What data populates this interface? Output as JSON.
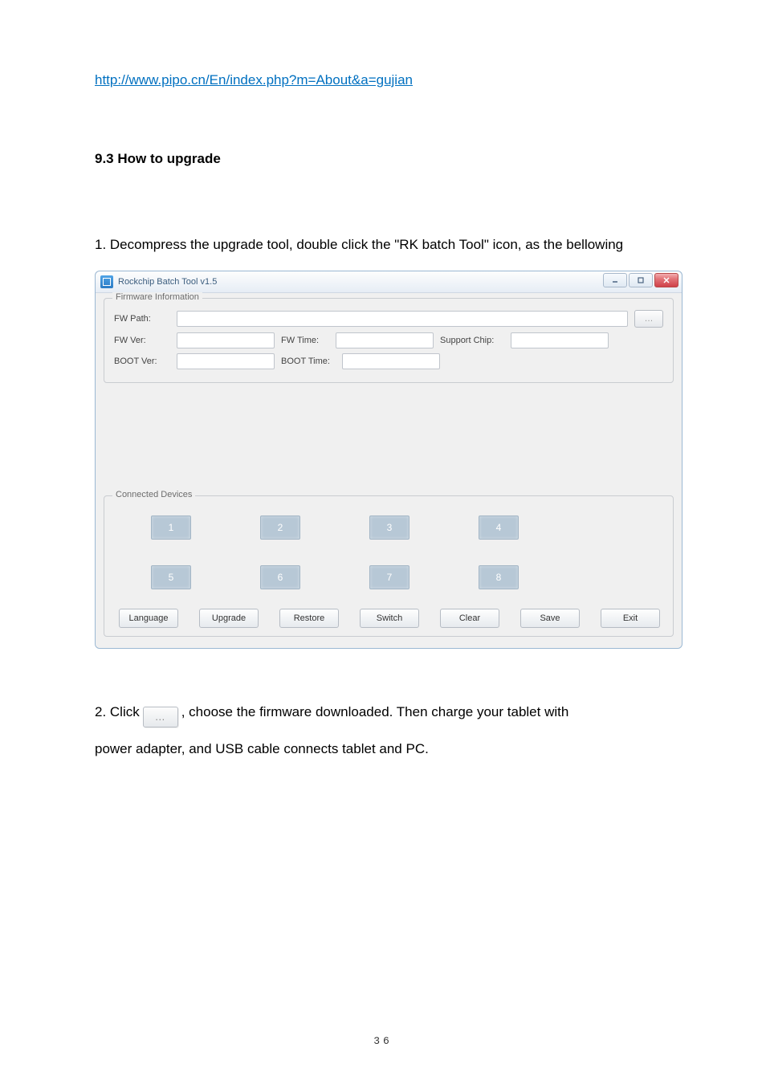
{
  "link_url": "http://www.pipo.cn/En/index.php?m=About&a=gujian",
  "heading": "9.3 How to upgrade",
  "para1": "1. Decompress the upgrade tool, double click the \"RK batch Tool\" icon, as the bellowing",
  "app": {
    "title": "Rockchip Batch Tool v1.5",
    "firmware_legend": "Firmware Information",
    "fw_path_label": "FW Path:",
    "fw_ver_label": "FW Ver:",
    "fw_time_label": "FW Time:",
    "support_chip_label": "Support Chip:",
    "boot_ver_label": "BOOT Ver:",
    "boot_time_label": "BOOT Time:",
    "browse_label": "…",
    "devices_legend": "Connected Devices",
    "slots": [
      "1",
      "2",
      "3",
      "4",
      "5",
      "6",
      "7",
      "8"
    ],
    "buttons": {
      "language": "Language",
      "upgrade": "Upgrade",
      "restore": "Restore",
      "switch": "Switch",
      "clear": "Clear",
      "save": "Save",
      "exit": "Exit"
    }
  },
  "para2_pre": "2. Click",
  "inline_btn_label": "…",
  "para2_post": ", choose the firmware downloaded. Then charge your tablet with",
  "para3": "power adapter, and USB cable connects tablet and PC.",
  "page_number": "36"
}
